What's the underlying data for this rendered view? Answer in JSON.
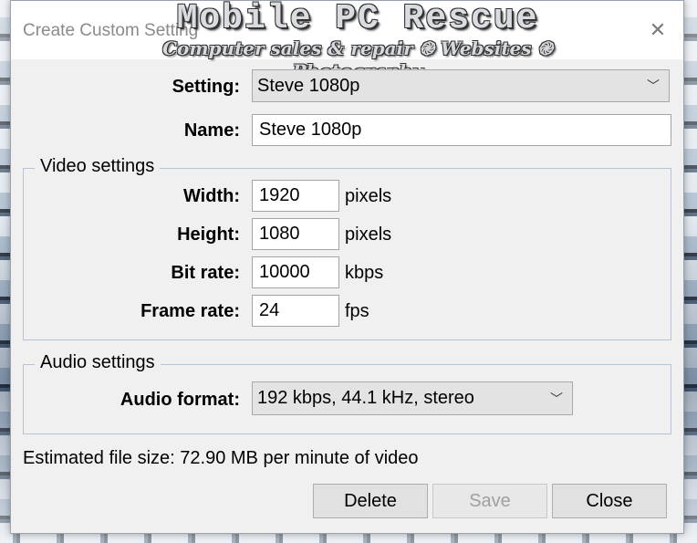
{
  "watermark": {
    "title": "Mobile PC Rescue",
    "subtitle": "Computer sales & repair ֎ Websites ֎ Photography"
  },
  "dialog": {
    "title": "Create Custom Setting",
    "close_icon": "close-icon"
  },
  "setting": {
    "label": "Setting:",
    "value": "Steve 1080p"
  },
  "name": {
    "label": "Name:",
    "value": "Steve 1080p"
  },
  "video": {
    "legend": "Video settings",
    "width": {
      "label": "Width:",
      "value": "1920",
      "unit": "pixels"
    },
    "height": {
      "label": "Height:",
      "value": "1080",
      "unit": "pixels"
    },
    "bitrate": {
      "label": "Bit rate:",
      "value": "10000",
      "unit": "kbps"
    },
    "framerate": {
      "label": "Frame rate:",
      "value": "24",
      "unit": "fps"
    }
  },
  "audio": {
    "legend": "Audio settings",
    "format": {
      "label": "Audio format:",
      "value": "192 kbps, 44.1 kHz, stereo"
    }
  },
  "estimate": "Estimated file size: 72.90 MB per minute of video",
  "buttons": {
    "delete": "Delete",
    "save": "Save",
    "close": "Close"
  }
}
